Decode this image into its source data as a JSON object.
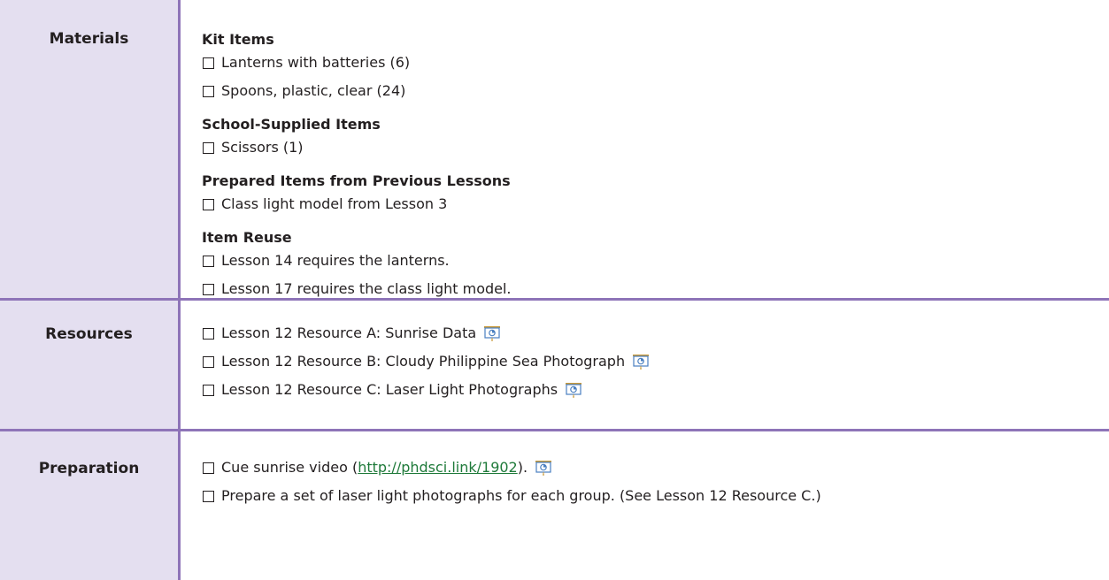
{
  "materials": {
    "label": "Materials",
    "groups": [
      {
        "heading": "Kit Items",
        "items": [
          "Lanterns with batteries (6)",
          "Spoons, plastic, clear (24)"
        ]
      },
      {
        "heading": "School-Supplied Items",
        "items": [
          "Scissors (1)"
        ]
      },
      {
        "heading": "Prepared Items from Previous Lessons",
        "items": [
          "Class light model from Lesson 3"
        ]
      },
      {
        "heading": "Item Reuse",
        "items": [
          "Lesson 14 requires the lanterns.",
          "Lesson 17 requires the class light model."
        ]
      }
    ]
  },
  "resources": {
    "label": "Resources",
    "items": [
      "Lesson 12 Resource A: Sunrise Data",
      "Lesson 12 Resource B: Cloudy Philippine Sea Photograph",
      "Lesson 12 Resource C: Laser Light Photographs"
    ]
  },
  "preparation": {
    "label": "Preparation",
    "video_prefix": "Cue sunrise video (",
    "video_link": "http://phdsci.link/1902",
    "video_suffix": ").",
    "item2": "Prepare a set of laser light photographs for each group. (See Lesson 12 Resource C.)"
  },
  "colors": {
    "border": "#8e74b8",
    "label_bg": "#e4dff0",
    "link": "#1f7a3a",
    "icon_frame": "#c99a3a",
    "icon_screen": "#4a7fc0"
  },
  "icons": {
    "presentation": "presentation-screen-icon",
    "checkbox": "checkbox-icon"
  }
}
